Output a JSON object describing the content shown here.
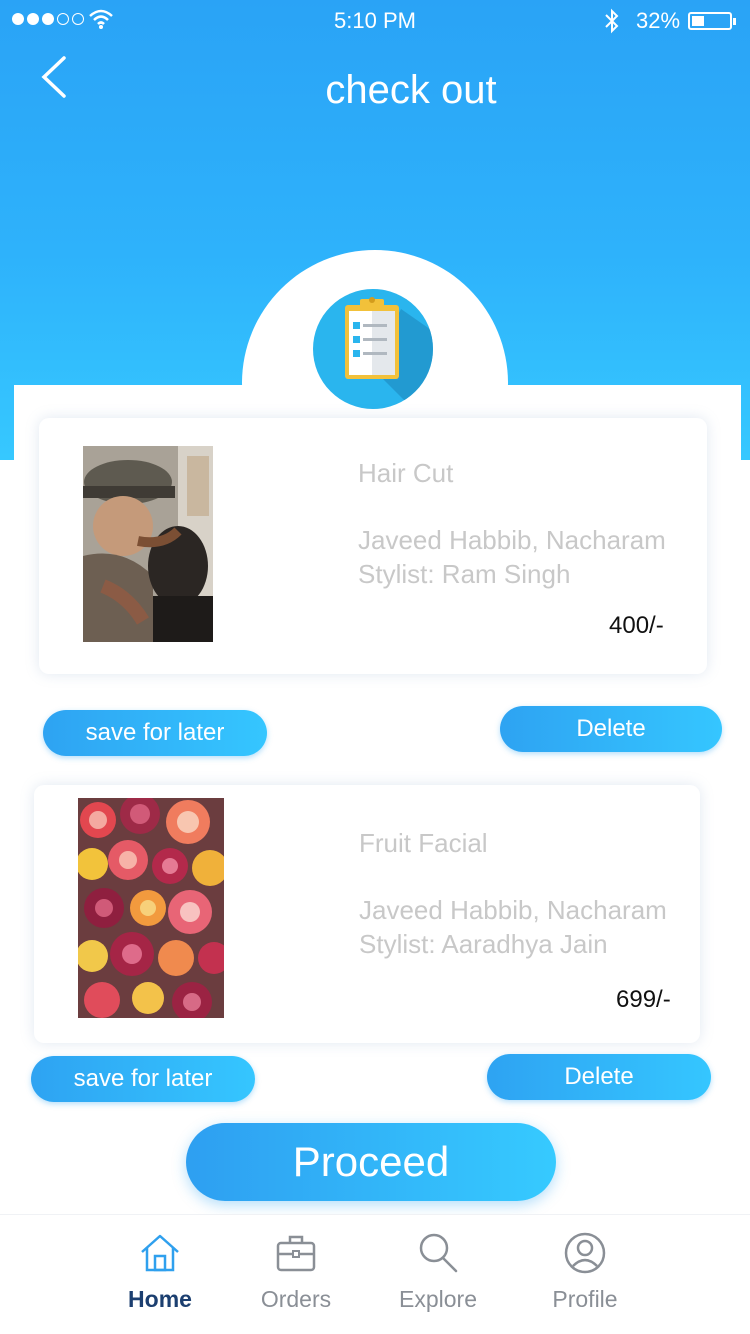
{
  "status_bar": {
    "time": "5:10 PM",
    "battery": "32%"
  },
  "header": {
    "title": "check out"
  },
  "items": [
    {
      "name": "Hair Cut",
      "salon": "Javeed Habbib, Nacharam",
      "stylist": "Stylist: Ram Singh",
      "price": "400/-",
      "save_label": "save for later",
      "delete_label": "Delete"
    },
    {
      "name": "Fruit Facial",
      "salon": "Javeed Habbib, Nacharam",
      "stylist": "Stylist: Aaradhya Jain",
      "price": "699/-",
      "save_label": "save for later",
      "delete_label": "Delete"
    }
  ],
  "proceed_label": "Proceed",
  "tabs": [
    {
      "label": "Home",
      "icon": "home-icon",
      "active": true
    },
    {
      "label": "Orders",
      "icon": "briefcase-icon",
      "active": false
    },
    {
      "label": "Explore",
      "icon": "search-icon",
      "active": false
    },
    {
      "label": "Profile",
      "icon": "profile-icon",
      "active": false
    }
  ],
  "colors": {
    "accent": "#2eb2fb",
    "active_tab": "#1c3f70",
    "muted_text": "#c8c8c8"
  }
}
